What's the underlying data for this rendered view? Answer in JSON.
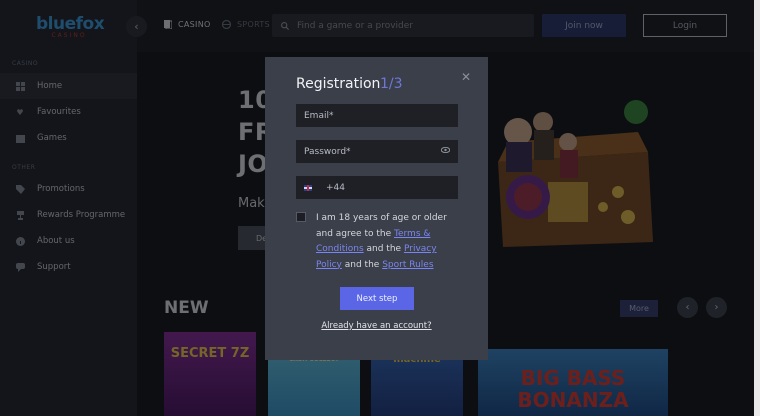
{
  "brand": {
    "name": "bluefox",
    "tagline": "CASINO"
  },
  "sidebar": {
    "casino_label": "CASINO",
    "other_label": "OTHER",
    "casino_items": [
      {
        "label": "Home",
        "icon": "grid-icon"
      },
      {
        "label": "Favourites",
        "icon": "heart-icon"
      },
      {
        "label": "Games",
        "icon": "gift-icon"
      }
    ],
    "other_items": [
      {
        "label": "Promotions",
        "icon": "tag-icon"
      },
      {
        "label": "Rewards Programme",
        "icon": "trophy-icon"
      },
      {
        "label": "About us",
        "icon": "info-icon"
      },
      {
        "label": "Support",
        "icon": "chat-icon"
      }
    ]
  },
  "topbar": {
    "casino_tab": "CASINO",
    "sports_tab": "SPORTS",
    "search_placeholder": "Find a game or a provider",
    "join_label": "Join now",
    "login_label": "Login"
  },
  "hero": {
    "line1": "100",
    "line2": "FRI",
    "line3": "JO",
    "make_text": "Make",
    "button_label": "De"
  },
  "new_section": {
    "title": "NEW",
    "more_label": "More",
    "games": [
      "SECRET 7Z",
      "CASH COLLECT",
      "machine",
      "BIG BASS BONANZA"
    ]
  },
  "registration": {
    "title": "Registration",
    "step": "1/3",
    "email_placeholder": "Email*",
    "password_placeholder": "Password*",
    "phone_prefix": "+44",
    "terms_prefix": "I am 18 years of age or older and agree to the",
    "terms_link": "Terms & Conditions",
    "and_the_1": "and the",
    "privacy_link": "Privacy Policy",
    "and_the_2": "and the",
    "sport_rules_link": "Sport Rules",
    "next_label": "Next step",
    "have_account": "Already have an account?"
  },
  "colors": {
    "accent": "#5a66e6",
    "link": "#7a86ef",
    "modal_bg": "#3b3f4a",
    "sidebar_bg": "#1f2228"
  }
}
